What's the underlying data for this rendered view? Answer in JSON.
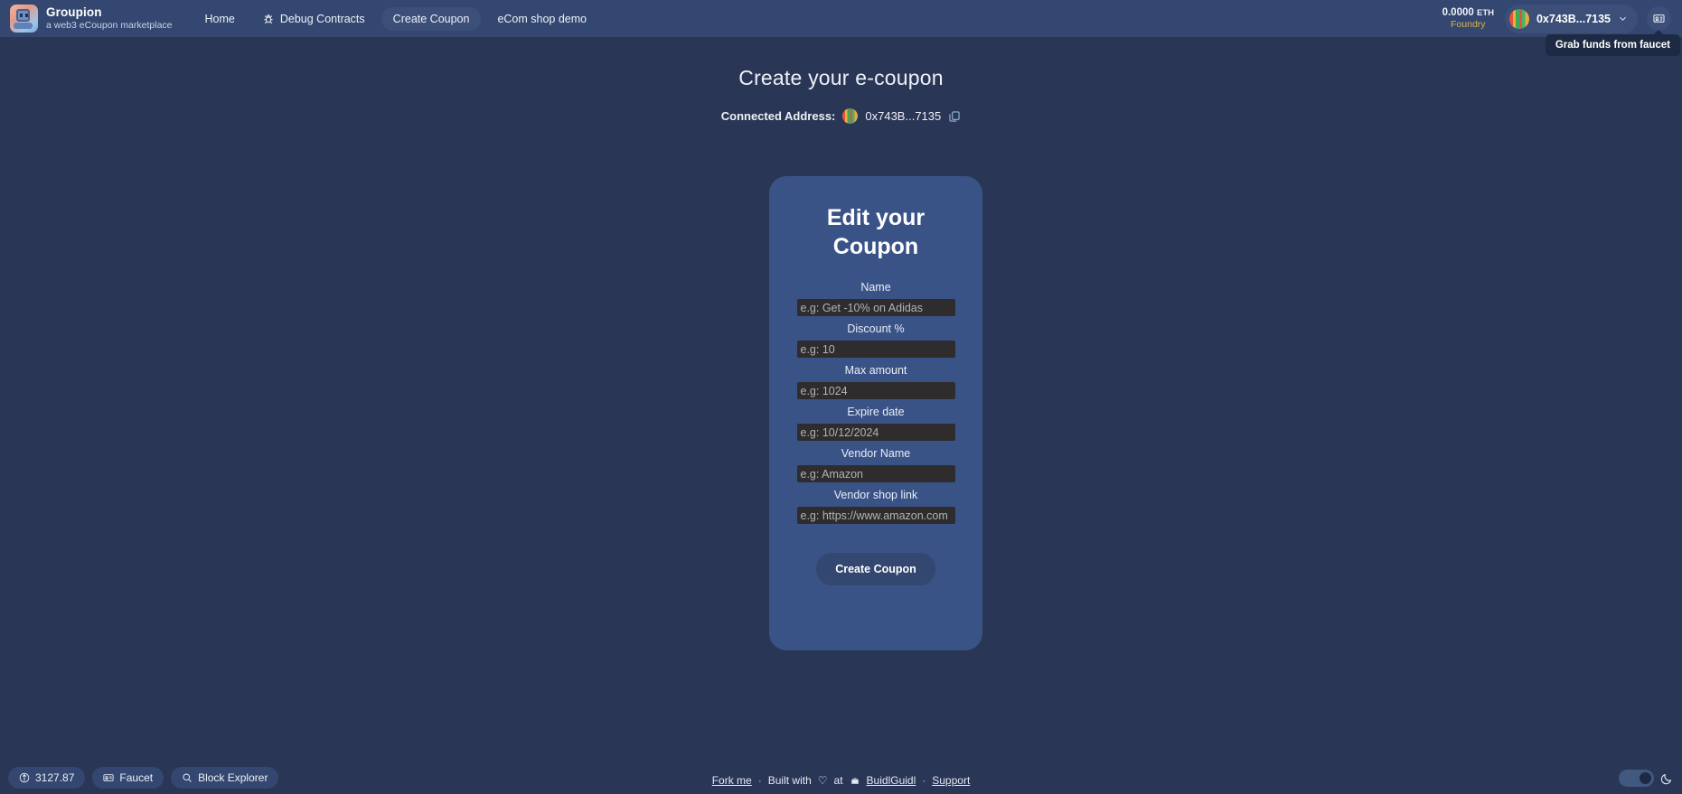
{
  "header": {
    "brand": {
      "title": "Groupion",
      "subtitle": "a web3 eCoupon marketplace",
      "logo_icon": "robot-logo-icon"
    },
    "nav": [
      {
        "label": "Home",
        "active": false,
        "icon": null
      },
      {
        "label": "Debug Contracts",
        "active": false,
        "icon": "bug-icon"
      },
      {
        "label": "Create Coupon",
        "active": true,
        "icon": null
      },
      {
        "label": "eCom shop demo",
        "active": false,
        "icon": null
      }
    ],
    "balance": {
      "amount": "0.0000",
      "unit": "ETH",
      "network": "Foundry"
    },
    "wallet": {
      "address": "0x743B...7135",
      "chevron_icon": "chevron-down-icon",
      "avatar_icon": "wallet-avatar-icon"
    },
    "faucet": {
      "icon": "faucet-card-icon",
      "tooltip": "Grab funds from faucet"
    }
  },
  "main": {
    "page_title": "Create your e-coupon",
    "connected": {
      "label": "Connected Address:",
      "address": "0x743B...7135",
      "avatar_icon": "address-avatar-icon",
      "copy_icon": "copy-icon"
    },
    "card": {
      "title": "Edit your Coupon",
      "fields": [
        {
          "label": "Name",
          "placeholder": "e.g: Get -10% on Adidas",
          "value": ""
        },
        {
          "label": "Discount %",
          "placeholder": "e.g: 10",
          "value": ""
        },
        {
          "label": "Max amount",
          "placeholder": "e.g: 1024",
          "value": ""
        },
        {
          "label": "Expire date",
          "placeholder": "e.g: 10/12/2024",
          "value": ""
        },
        {
          "label": "Vendor Name",
          "placeholder": "e.g: Amazon",
          "value": ""
        },
        {
          "label": "Vendor shop link",
          "placeholder": "e.g: https://www.amazon.com",
          "value": ""
        }
      ],
      "submit_label": "Create Coupon"
    }
  },
  "footer": {
    "price": {
      "value": "3127.87",
      "icon": "eth-currency-icon"
    },
    "faucet_chip": {
      "label": "Faucet",
      "icon": "faucet-card-icon"
    },
    "explorer_chip": {
      "label": "Block Explorer",
      "icon": "search-icon"
    },
    "fork_me": "Fork me",
    "built_with_prefix": "Built with",
    "heart": "♡",
    "built_with_at": "at",
    "buidlguidl": "BuidlGuidl",
    "support": "Support",
    "separator": "·",
    "theme_toggle": {
      "state": "dark",
      "moon_icon": "moon-icon"
    }
  },
  "colors": {
    "page_bg": "#2a3655",
    "header_bg": "#334770",
    "card_bg": "#3a5387",
    "accent": "#3b4f79",
    "network_color": "#d9b44a",
    "input_bg": "#2e2c2c"
  }
}
